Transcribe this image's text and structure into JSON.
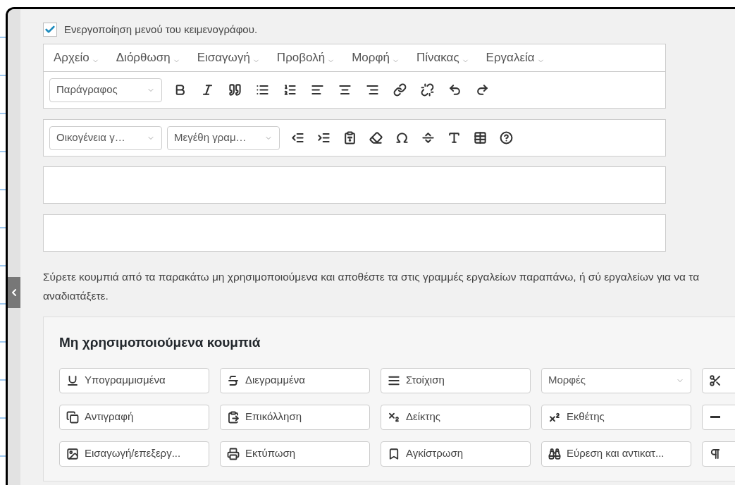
{
  "editor_menu_option": {
    "label": "Ενεργοποίηση μενού του κειμενογράφου.",
    "checked": true
  },
  "menubar": [
    "Αρχείο",
    "Διόρθωση",
    "Εισαγωγή",
    "Προβολή",
    "Μορφή",
    "Πίνακας",
    "Εργαλεία"
  ],
  "toolbar_1": {
    "selects": [
      "Παράγραφος"
    ]
  },
  "toolbar_2": {
    "selects": [
      "Οικογένεια γ…",
      "Μεγέθη γραμ…"
    ]
  },
  "help_text": "Σύρετε κουμπιά από τα παρακάτω μη χρησιμοποιούμενα και αποθέστε τα στις γραμμές εργαλείων παραπάνω, ή σύ εργαλείων για να τα αναδιατάξετε.",
  "unused_panel": {
    "title": "Μη χρησιμοποιούμενα κουμπιά",
    "items": [
      {
        "kind": "button",
        "label": "Υπογραμμισμένα"
      },
      {
        "kind": "button",
        "label": "Διεγραμμένα"
      },
      {
        "kind": "button",
        "label": "Στοίχιση"
      },
      {
        "kind": "select",
        "label": "Μορφές"
      },
      {
        "kind": "button"
      },
      {
        "kind": "button",
        "label": "Αντιγραφή"
      },
      {
        "kind": "button",
        "label": "Επικόλληση"
      },
      {
        "kind": "button",
        "label": "Δείκτης"
      },
      {
        "kind": "button",
        "label": "Εκθέτης"
      },
      {
        "kind": "button"
      },
      {
        "kind": "button",
        "label": "Εισαγωγή/επεξεργ..."
      },
      {
        "kind": "button",
        "label": "Εκτύπωση"
      },
      {
        "kind": "button",
        "label": "Αγκίστρωση"
      },
      {
        "kind": "button",
        "label": "Εύρεση και αντικατ..."
      },
      {
        "kind": "button"
      }
    ]
  }
}
